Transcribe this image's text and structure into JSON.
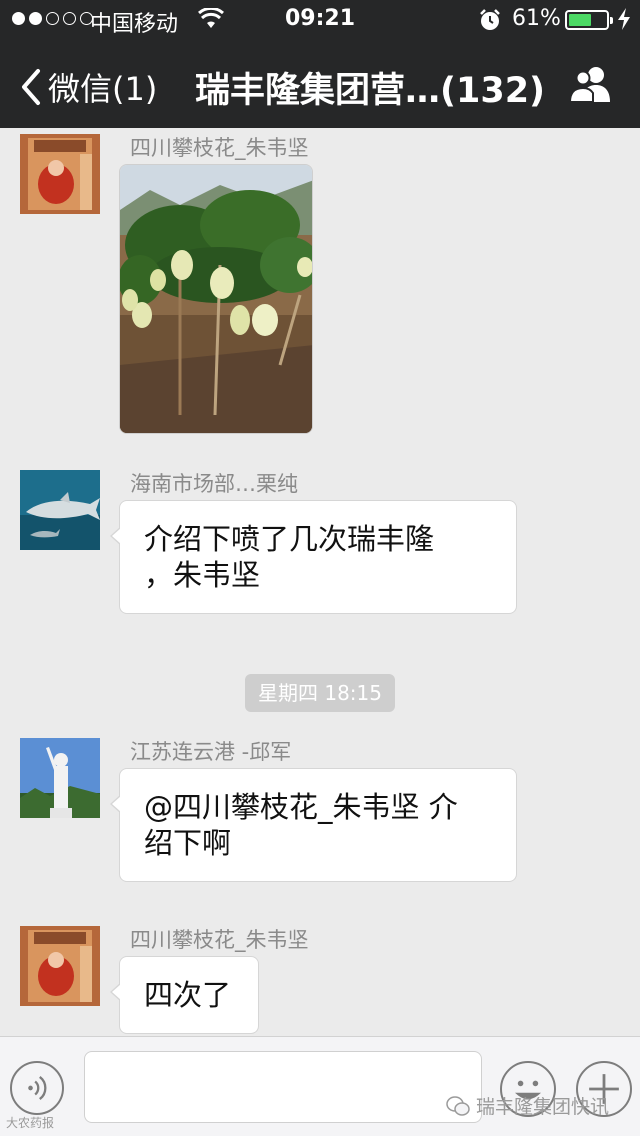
{
  "status_bar": {
    "carrier": "中国移动",
    "time": "09:21",
    "battery_percent_text": "61%",
    "battery_level": 0.61,
    "signal_bars_filled": 2,
    "signal_bars_total": 5
  },
  "nav": {
    "back_label": "微信(1)",
    "title": "瑞丰隆集团营…(132)",
    "group_icon": "group-people-icon"
  },
  "messages": [
    {
      "sender": "四川攀枝花_朱韦坚",
      "type": "image"
    },
    {
      "sender": "海南市场部…栗纯",
      "type": "text",
      "lines": [
        "介绍下喷了几次瑞丰隆",
        "，朱韦坚"
      ]
    },
    {
      "sender": "江苏连云港 -邱军",
      "type": "text",
      "lines": [
        "@四川攀枝花_朱韦坚 介",
        "绍下啊"
      ]
    },
    {
      "sender": "四川攀枝花_朱韦坚",
      "type": "text",
      "lines": [
        "四次了"
      ]
    }
  ],
  "timestamp": "星期四 18:15",
  "input": {
    "value": "",
    "voice_icon": "voice-icon",
    "emoji_icon": "emoji-icon",
    "plus_icon": "plus-icon"
  },
  "watermarks": {
    "left": "大农药报",
    "right": "瑞丰隆集团快讯"
  },
  "colors": {
    "header": "#262728",
    "chat_background": "#ebebeb",
    "battery": "#4cd964"
  }
}
